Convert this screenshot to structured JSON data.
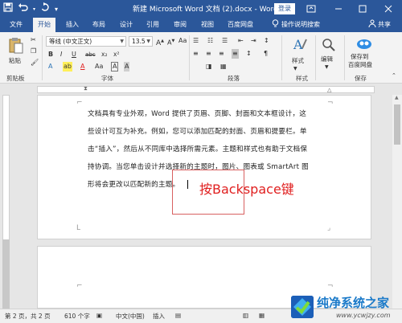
{
  "titlebar": {
    "title": "新建 Microsoft Word 文档 (2).docx  -  Word",
    "login": "登录",
    "qat": {
      "save_icon": "save-icon",
      "undo_icon": "undo-icon",
      "redo_icon": "redo-icon",
      "customize_icon": "chevron-down-icon"
    }
  },
  "tabs": [
    {
      "label": "文件"
    },
    {
      "label": "开始"
    },
    {
      "label": "插入"
    },
    {
      "label": "布局"
    },
    {
      "label": "设计"
    },
    {
      "label": "引用"
    },
    {
      "label": "审阅"
    },
    {
      "label": "视图"
    },
    {
      "label": "百度网盘"
    },
    {
      "label": "操作说明搜索"
    }
  ],
  "share": "共享",
  "ribbon": {
    "paste": "粘贴",
    "clipboard": "剪贴板",
    "font_name": "等线 (中文正文)",
    "font_size": "13.5",
    "font_group": "字体",
    "paragraph_group": "段落",
    "styles": "样式",
    "editing": "编辑",
    "save_to": "保存到",
    "baidu": "百度网盘",
    "save_group": "保存",
    "styles_group": "样式",
    "font_btns": [
      "B",
      "I",
      "U",
      "abc",
      "x₂",
      "x²"
    ],
    "font_btns2": [
      "A",
      "ab",
      "A",
      "Aa",
      "A",
      "A"
    ],
    "para_btns": [
      "≡",
      "≡",
      "≡",
      "≡",
      "↕",
      "¶"
    ]
  },
  "document": {
    "lines": [
      "文档具有专业外观，Word 提供了页眉、页脚、封面和文本框设计，这",
      "些设计可互为补充。例如，您可以添加匹配的封面、页眉和提要栏。单",
      "击“插入”，然后从不同库中选择所需元素。主题和样式也有助于文档保",
      "持协调。当您单击设计并选择新的主题时，图片、图表或 SmartArt 图",
      "形将会更改以匹配新的主题。"
    ],
    "annotation": "按Backspace键"
  },
  "status": {
    "page": "第 2 页，共 2 页",
    "words": "610 个字",
    "language": "中文(中国)",
    "mode": "插入"
  },
  "watermark": {
    "title": "纯净系统之家",
    "url": "www.ycwjzy.com"
  }
}
